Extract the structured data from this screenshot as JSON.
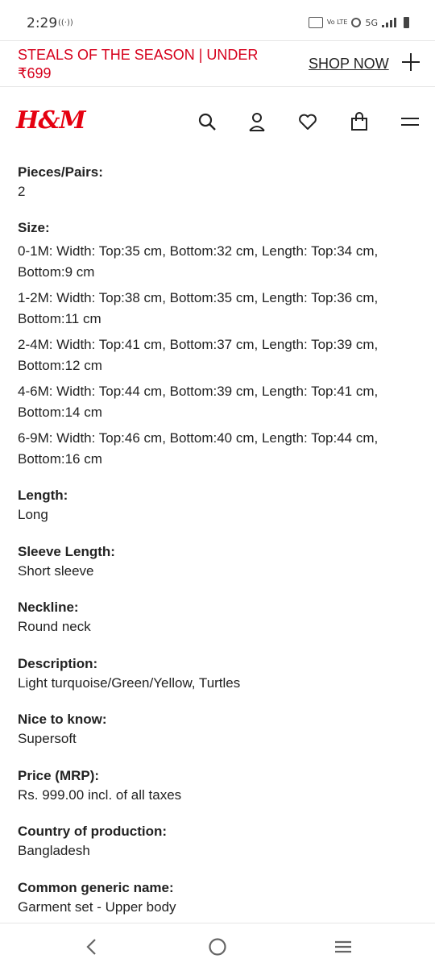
{
  "status_bar": {
    "time": "2:29",
    "network": "5G",
    "volte_label": "Vo LTE",
    "hotspot_glyph": "((·))"
  },
  "promo": {
    "text": "STEALS OF THE SEASON | UNDER ₹699",
    "link_label": "SHOP NOW",
    "accent_color": "#d6001c"
  },
  "header": {
    "logo": "H&M",
    "icons": [
      "search-icon",
      "account-icon",
      "favorites-icon",
      "shopping-bag-icon",
      "menu-icon"
    ]
  },
  "details": {
    "pieces": {
      "label": "Pieces/Pairs:",
      "value": "2"
    },
    "size": {
      "label": "Size:",
      "lines": [
        "0-1M: Width: Top:35 cm, Bottom:32 cm, Length: Top:34 cm, Bottom:9 cm",
        "1-2M: Width: Top:38 cm, Bottom:35 cm, Length: Top:36 cm, Bottom:11 cm",
        "2-4M: Width: Top:41 cm, Bottom:37 cm, Length: Top:39 cm, Bottom:12 cm",
        "4-6M: Width: Top:44 cm, Bottom:39 cm, Length: Top:41 cm, Bottom:14 cm",
        "6-9M: Width: Top:46 cm, Bottom:40 cm, Length: Top:44 cm, Bottom:16 cm"
      ]
    },
    "length": {
      "label": "Length:",
      "value": "Long"
    },
    "sleeve": {
      "label": "Sleeve Length:",
      "value": "Short sleeve"
    },
    "neckline": {
      "label": "Neckline:",
      "value": "Round neck"
    },
    "description": {
      "label": "Description:",
      "value": "Light turquoise/Green/Yellow, Turtles"
    },
    "nice": {
      "label": "Nice to know:",
      "value": "Supersoft"
    },
    "price": {
      "label": "Price (MRP):",
      "value": "Rs. 999.00 incl. of all taxes"
    },
    "country": {
      "label": "Country of production:",
      "value": "Bangladesh"
    },
    "generic": {
      "label": "Common generic name:",
      "value": "Garment set - Upper body"
    }
  },
  "nav_bar": {
    "buttons": [
      "back-icon",
      "home-icon",
      "recent-apps-icon"
    ]
  }
}
